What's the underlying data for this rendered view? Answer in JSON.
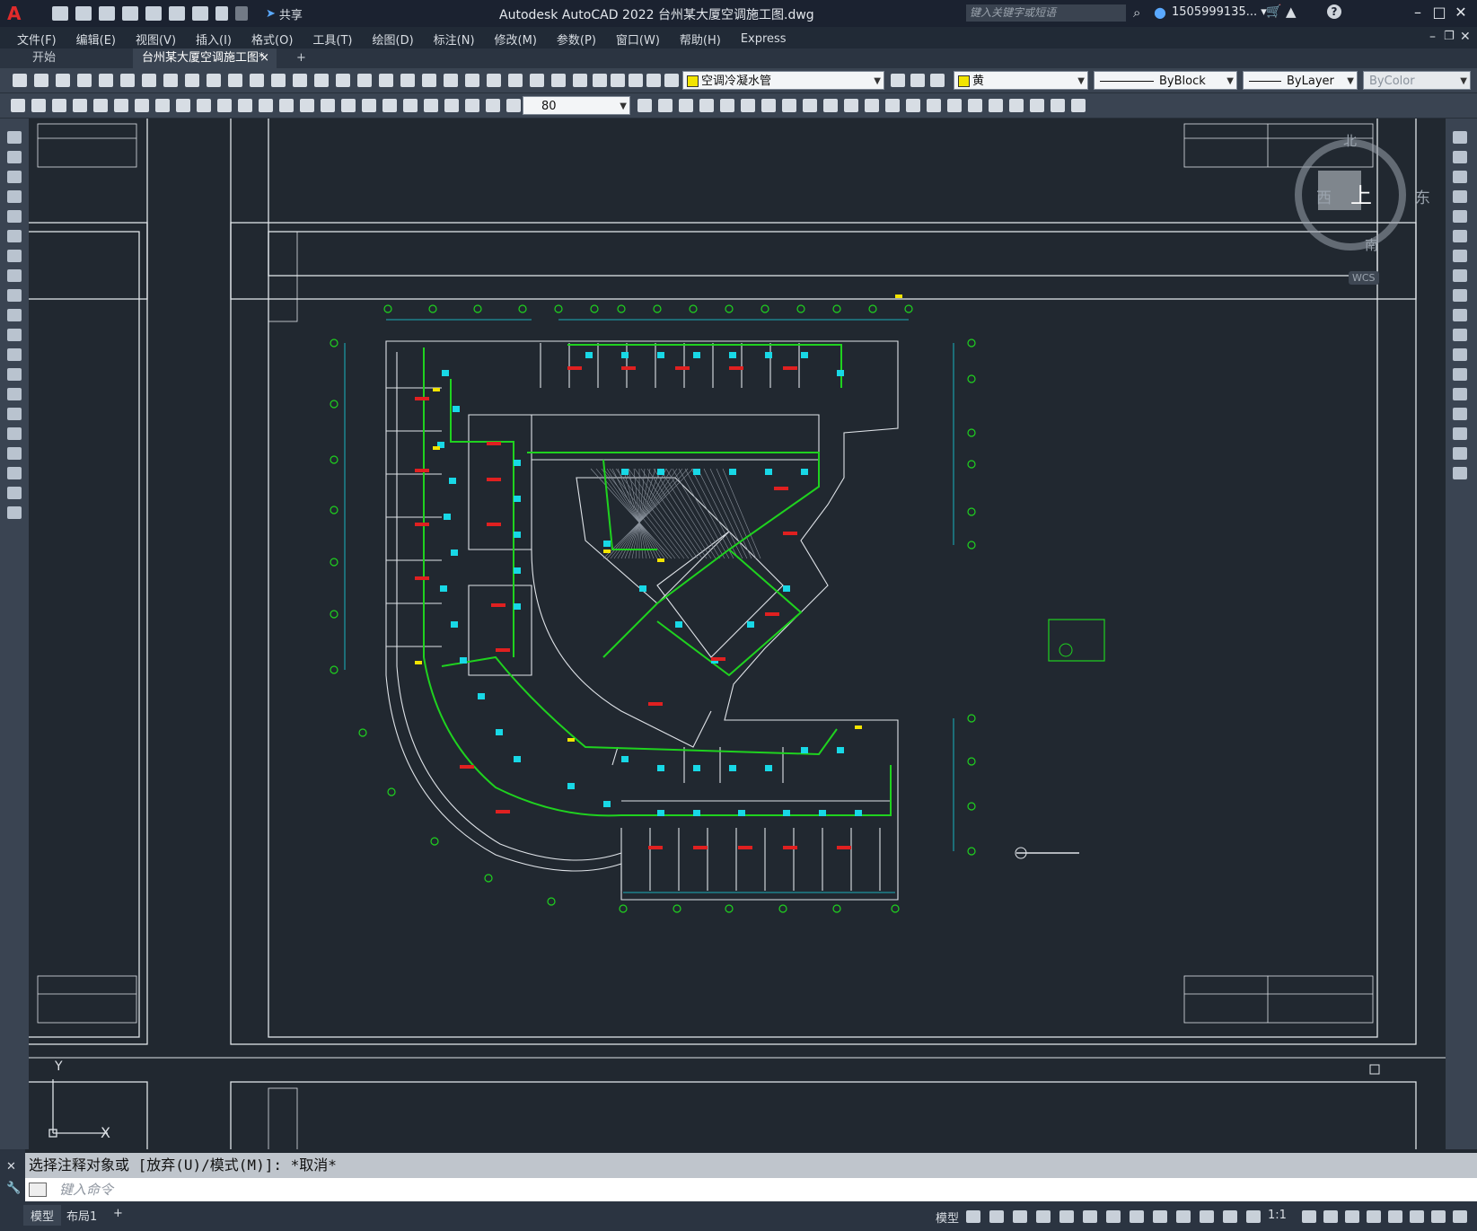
{
  "titlebar": {
    "logo": "A",
    "share": "共享",
    "title": "Autodesk AutoCAD 2022    台州某大厦空调施工图.dwg",
    "search_placeholder": "键入关键字或短语",
    "user": "1505999135... ▾",
    "help": "?"
  },
  "menu": [
    "文件(F)",
    "编辑(E)",
    "视图(V)",
    "插入(I)",
    "格式(O)",
    "工具(T)",
    "绘图(D)",
    "标注(N)",
    "修改(M)",
    "参数(P)",
    "窗口(W)",
    "帮助(H)",
    "Express"
  ],
  "tabs": {
    "start": "开始",
    "active": "台州某大厦空调施工图*",
    "close": "×",
    "add": "+"
  },
  "toolbar1": {
    "layer": "空调冷凝水管",
    "color": "黄",
    "linetype": "ByBlock",
    "lineweight": "ByLayer",
    "plotstyle": "ByColor"
  },
  "toolbar2": {
    "dimscale": "80"
  },
  "viewcube": {
    "north": "北",
    "south": "南",
    "east": "东",
    "west": "西",
    "top": "上",
    "wcs": "WCS"
  },
  "ucs": {
    "y": "Y",
    "x": "X"
  },
  "command": {
    "history": "选择注释对象或 [放弃(U)/模式(M)]: *取消*",
    "placeholder": "键入命令"
  },
  "status": {
    "model_tab": "模型",
    "layout_tab": "布局1",
    "add": "+",
    "model_label": "模型",
    "scale": "1:1"
  },
  "colors": {
    "background": "#212830",
    "grid_green": "#1fd21f",
    "equipment_cyan": "#18d8e6",
    "room_red": "#e02020",
    "wall_white": "#dfe3e8",
    "accent_yellow": "#f2e400"
  }
}
